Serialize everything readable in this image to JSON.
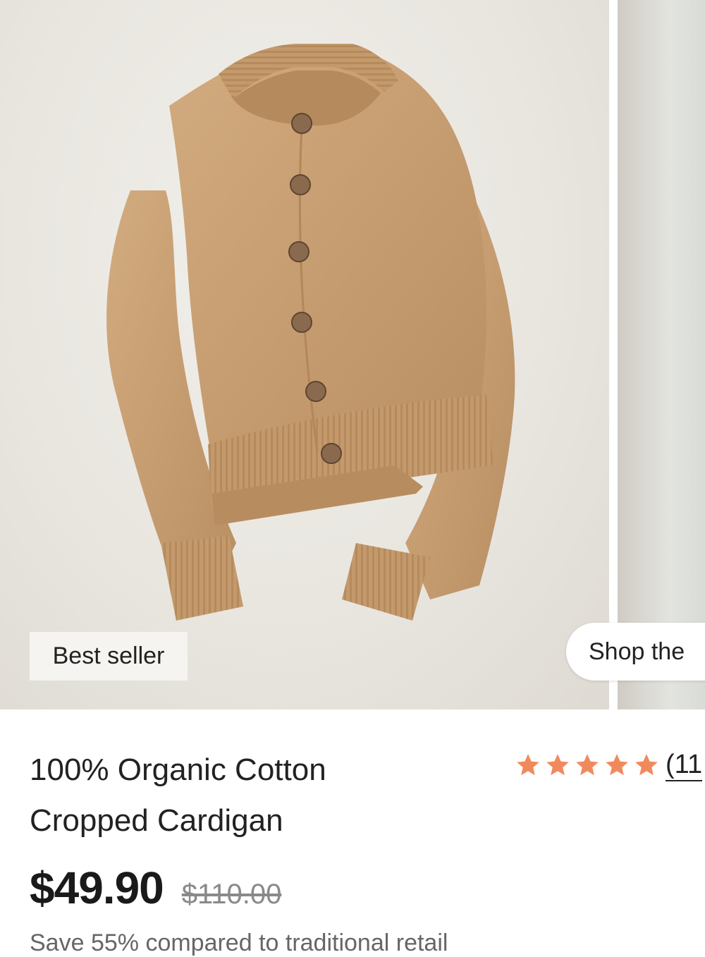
{
  "badge": {
    "label": "Best seller"
  },
  "carousel": {
    "shop_label": "Shop the"
  },
  "product": {
    "title_line1": "100% Organic Cotton",
    "title_line2": "Cropped Cardigan",
    "price": "$49.90",
    "original_price": "$110.00",
    "savings_text": "Save 55% compared to traditional retail"
  },
  "rating": {
    "stars": 5,
    "count_text": "(11",
    "star_color": "#f08a5d"
  },
  "colors": {
    "sweater": "#c9a073",
    "background": "#e9e6e0"
  }
}
